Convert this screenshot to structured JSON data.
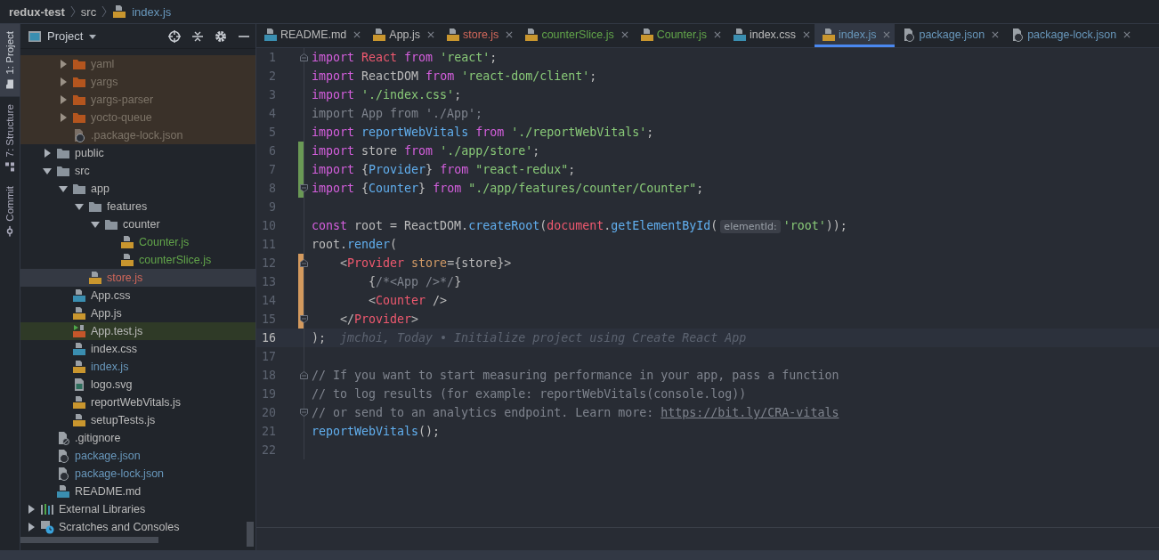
{
  "breadcrumb": [
    {
      "label": "redux-test",
      "kind": "project"
    },
    {
      "label": "src",
      "kind": "folder"
    },
    {
      "label": "index.js",
      "kind": "js"
    }
  ],
  "tool_strip": [
    {
      "label": "1: Project",
      "kind": "project",
      "selected": true
    },
    {
      "label": "7: Structure",
      "kind": "structure",
      "selected": false
    },
    {
      "label": "Commit",
      "kind": "commit",
      "selected": false
    }
  ],
  "project_panel": {
    "title": "Project",
    "tree": [
      {
        "children": [
          {
            "children": [
              {
                "label": "yaml",
                "kind": "folder",
                "expanded": false,
                "excluded": true,
                "selected": false,
                "color": "#7d7468"
              },
              {
                "label": "yargs",
                "kind": "folder",
                "expanded": false,
                "excluded": true,
                "selected": false,
                "color": "#7d7468"
              },
              {
                "label": "yargs-parser",
                "kind": "folder",
                "expanded": false,
                "excluded": true,
                "selected": false,
                "color": "#7d7468"
              },
              {
                "label": "yocto-queue",
                "kind": "folder",
                "expanded": false,
                "excluded": true,
                "selected": false,
                "color": "#7d7468"
              },
              {
                "label": ".package-lock.json",
                "kind": "json",
                "excluded": true,
                "selected": false,
                "color": "#7d7468"
              }
            ]
          },
          {
            "label": "public",
            "kind": "folder",
            "expanded": false,
            "excluded": false,
            "selected": false,
            "color": "#bbbbbb"
          },
          {
            "label": "src",
            "kind": "folder",
            "expanded": true,
            "excluded": false,
            "selected": false,
            "color": "#bbbbbb",
            "children": [
              {
                "label": "app",
                "kind": "folder",
                "expanded": true,
                "excluded": false,
                "selected": false,
                "color": "#bbbbbb",
                "children": [
                  {
                    "label": "features",
                    "kind": "folder",
                    "expanded": true,
                    "excluded": false,
                    "selected": false,
                    "color": "#bbbbbb",
                    "children": [
                      {
                        "label": "counter",
                        "kind": "folder",
                        "expanded": true,
                        "excluded": false,
                        "selected": false,
                        "color": "#bbbbbb",
                        "children": [
                          {
                            "label": "Counter.js",
                            "kind": "js",
                            "excluded": false,
                            "selected": false,
                            "color": "#62a54a"
                          },
                          {
                            "label": "counterSlice.js",
                            "kind": "js",
                            "excluded": false,
                            "selected": false,
                            "color": "#62a54a"
                          }
                        ]
                      }
                    ]
                  },
                  {
                    "label": "store.js",
                    "kind": "js",
                    "excluded": false,
                    "selected": true,
                    "color": "#d1675a"
                  }
                ]
              },
              {
                "label": "App.css",
                "kind": "css",
                "excluded": false,
                "selected": false,
                "color": "#bbbbbb"
              },
              {
                "label": "App.js",
                "kind": "js",
                "excluded": false,
                "selected": false,
                "color": "#bbbbbb"
              },
              {
                "label": "App.test.js",
                "kind": "test",
                "excluded": false,
                "selected": false,
                "color": "#bbbbbb"
              },
              {
                "label": "index.css",
                "kind": "css",
                "excluded": false,
                "selected": false,
                "color": "#bbbbbb"
              },
              {
                "label": "index.js",
                "kind": "js",
                "excluded": false,
                "selected": false,
                "color": "#6897bb"
              },
              {
                "label": "logo.svg",
                "kind": "image",
                "excluded": false,
                "selected": false,
                "color": "#bbbbbb"
              },
              {
                "label": "reportWebVitals.js",
                "kind": "js",
                "excluded": false,
                "selected": false,
                "color": "#bbbbbb"
              },
              {
                "label": "setupTests.js",
                "kind": "js",
                "excluded": false,
                "selected": false,
                "color": "#bbbbbb"
              }
            ]
          },
          {
            "label": ".gitignore",
            "kind": "ignore",
            "excluded": false,
            "selected": false,
            "color": "#bbbbbb"
          },
          {
            "label": "package.json",
            "kind": "json",
            "excluded": false,
            "selected": false,
            "color": "#6897bb"
          },
          {
            "label": "package-lock.json",
            "kind": "json",
            "excluded": false,
            "selected": false,
            "color": "#6897bb"
          },
          {
            "label": "README.md",
            "kind": "md",
            "excluded": false,
            "selected": false,
            "color": "#bbbbbb"
          }
        ]
      },
      {
        "label": "External Libraries",
        "kind": "libraries",
        "expanded": false,
        "excluded": false,
        "selected": false,
        "color": "#bbbbbb"
      },
      {
        "label": "Scratches and Consoles",
        "kind": "scratches",
        "expanded": false,
        "excluded": false,
        "selected": false,
        "color": "#bbbbbb"
      }
    ]
  },
  "tabs": [
    {
      "label": "README.md",
      "kind": "md",
      "color": "#bbbbbb",
      "selected": false
    },
    {
      "label": "App.js",
      "kind": "js",
      "color": "#bbbbbb",
      "selected": false
    },
    {
      "label": "store.js",
      "kind": "js",
      "color": "#d1675a",
      "selected": false
    },
    {
      "label": "counterSlice.js",
      "kind": "js",
      "color": "#62a54a",
      "selected": false
    },
    {
      "label": "Counter.js",
      "kind": "js",
      "color": "#62a54a",
      "selected": false
    },
    {
      "label": "index.css",
      "kind": "css",
      "color": "#bbbbbb",
      "selected": false
    },
    {
      "label": "index.js",
      "kind": "js",
      "color": "#6897bb",
      "selected": true
    },
    {
      "label": "package.json",
      "kind": "json",
      "color": "#6897bb",
      "selected": false
    },
    {
      "label": "package-lock.json",
      "kind": "json",
      "color": "#6897bb",
      "selected": false
    }
  ],
  "editor": {
    "lines": [
      {
        "number": "1",
        "added": false,
        "modified": false,
        "fold_start": true,
        "fold_end": false,
        "current": false,
        "tokens": [
          {
            "kind": "keyword",
            "text": "import"
          },
          {
            "kind": "class",
            "text": " React"
          },
          {
            "kind": "keyword",
            "text": " from"
          },
          {
            "kind": "string",
            "text": " 'react'"
          },
          {
            "kind": "plain",
            "text": ";"
          }
        ]
      },
      {
        "number": "2",
        "added": false,
        "modified": false,
        "fold_start": false,
        "fold_end": false,
        "current": false,
        "tokens": [
          {
            "kind": "keyword",
            "text": "import"
          },
          {
            "kind": "plain",
            "text": " ReactDOM"
          },
          {
            "kind": "keyword",
            "text": " from"
          },
          {
            "kind": "string",
            "text": " 'react-dom/client'"
          },
          {
            "kind": "plain",
            "text": ";"
          }
        ]
      },
      {
        "number": "3",
        "added": false,
        "modified": false,
        "fold_start": false,
        "fold_end": false,
        "current": false,
        "tokens": [
          {
            "kind": "keyword",
            "text": "import"
          },
          {
            "kind": "string",
            "text": " './index.css'"
          },
          {
            "kind": "plain",
            "text": ";"
          }
        ]
      },
      {
        "number": "4",
        "added": false,
        "modified": false,
        "fold_start": false,
        "fold_end": false,
        "current": false,
        "tokens": [
          {
            "kind": "unused",
            "text": "import App from './App';"
          }
        ]
      },
      {
        "number": "5",
        "added": false,
        "modified": false,
        "fold_start": false,
        "fold_end": false,
        "current": false,
        "tokens": [
          {
            "kind": "keyword",
            "text": "import"
          },
          {
            "kind": "function",
            "text": " reportWebVitals"
          },
          {
            "kind": "keyword",
            "text": " from"
          },
          {
            "kind": "string",
            "text": " './reportWebVitals'"
          },
          {
            "kind": "plain",
            "text": ";"
          }
        ]
      },
      {
        "number": "6",
        "added": true,
        "modified": false,
        "fold_start": false,
        "fold_end": false,
        "current": false,
        "tokens": [
          {
            "kind": "keyword",
            "text": "import"
          },
          {
            "kind": "plain",
            "text": " store"
          },
          {
            "kind": "keyword",
            "text": " from"
          },
          {
            "kind": "string",
            "text": " './app/store'"
          },
          {
            "kind": "plain",
            "text": ";"
          }
        ]
      },
      {
        "number": "7",
        "added": true,
        "modified": false,
        "fold_start": false,
        "fold_end": false,
        "current": false,
        "tokens": [
          {
            "kind": "keyword",
            "text": "import"
          },
          {
            "kind": "plain",
            "text": " {"
          },
          {
            "kind": "function",
            "text": "Provider"
          },
          {
            "kind": "plain",
            "text": "}"
          },
          {
            "kind": "keyword",
            "text": " from"
          },
          {
            "kind": "string",
            "text": " \"react-redux\""
          },
          {
            "kind": "plain",
            "text": ";"
          }
        ]
      },
      {
        "number": "8",
        "added": true,
        "modified": false,
        "fold_start": false,
        "fold_end": true,
        "current": false,
        "tokens": [
          {
            "kind": "keyword",
            "text": "import"
          },
          {
            "kind": "plain",
            "text": " {"
          },
          {
            "kind": "function",
            "text": "Counter"
          },
          {
            "kind": "plain",
            "text": "}"
          },
          {
            "kind": "keyword",
            "text": " from"
          },
          {
            "kind": "string",
            "text": " \"./app/features/counter/Counter\""
          },
          {
            "kind": "plain",
            "text": ";"
          }
        ]
      },
      {
        "number": "9",
        "added": false,
        "modified": false,
        "fold_start": false,
        "fold_end": false,
        "current": false
      },
      {
        "number": "10",
        "added": false,
        "modified": false,
        "fold_start": false,
        "fold_end": false,
        "current": false,
        "tokens": [
          {
            "kind": "keyword",
            "text": "const"
          },
          {
            "kind": "plain",
            "text": " root = ReactDOM."
          },
          {
            "kind": "function",
            "text": "createRoot"
          },
          {
            "kind": "plain",
            "text": "("
          },
          {
            "kind": "global",
            "text": "document"
          },
          {
            "kind": "plain",
            "text": "."
          },
          {
            "kind": "function",
            "text": "getElementById"
          },
          {
            "kind": "plain",
            "text": "("
          },
          {
            "kind": "hint",
            "text": "elementId:"
          },
          {
            "kind": "string",
            "text": "'root'"
          },
          {
            "kind": "plain",
            "text": "));"
          }
        ]
      },
      {
        "number": "11",
        "added": false,
        "modified": false,
        "fold_start": false,
        "fold_end": false,
        "current": false,
        "tokens": [
          {
            "kind": "plain",
            "text": "root."
          },
          {
            "kind": "function",
            "text": "render"
          },
          {
            "kind": "plain",
            "text": "("
          }
        ]
      },
      {
        "number": "12",
        "added": false,
        "modified": true,
        "fold_start": true,
        "fold_end": false,
        "current": false,
        "tokens": [
          {
            "kind": "plain",
            "text": "    <"
          },
          {
            "kind": "tag",
            "text": "Provider"
          },
          {
            "kind": "attribute",
            "text": " store"
          },
          {
            "kind": "plain",
            "text": "={store}>"
          }
        ]
      },
      {
        "number": "13",
        "added": false,
        "modified": true,
        "fold_start": false,
        "fold_end": false,
        "current": false,
        "tokens": [
          {
            "kind": "plain",
            "text": "        {"
          },
          {
            "kind": "unused",
            "text": "/*<App />*/"
          },
          {
            "kind": "plain",
            "text": "}"
          }
        ]
      },
      {
        "number": "14",
        "added": false,
        "modified": true,
        "fold_start": false,
        "fold_end": false,
        "current": false,
        "tokens": [
          {
            "kind": "plain",
            "text": "        <"
          },
          {
            "kind": "tag",
            "text": "Counter"
          },
          {
            "kind": "plain",
            "text": " />"
          }
        ]
      },
      {
        "number": "15",
        "added": false,
        "modified": true,
        "fold_start": false,
        "fold_end": true,
        "current": false,
        "tokens": [
          {
            "kind": "plain",
            "text": "    </"
          },
          {
            "kind": "tag",
            "text": "Provider"
          },
          {
            "kind": "plain",
            "text": ">"
          }
        ]
      },
      {
        "number": "16",
        "added": false,
        "modified": false,
        "fold_start": false,
        "fold_end": false,
        "current": true,
        "tokens": [
          {
            "kind": "plain",
            "text": ");"
          }
        ],
        "annotation": "jmchoi, Today • Initialize project using Create React App"
      },
      {
        "number": "17",
        "added": false,
        "modified": false,
        "fold_start": false,
        "fold_end": false,
        "current": false
      },
      {
        "number": "18",
        "added": false,
        "modified": false,
        "fold_start": true,
        "fold_end": false,
        "current": false,
        "tokens": [
          {
            "kind": "comment",
            "text": "// If you want to start measuring performance in your app, pass a function"
          }
        ]
      },
      {
        "number": "19",
        "added": false,
        "modified": false,
        "fold_start": false,
        "fold_end": false,
        "current": false,
        "tokens": [
          {
            "kind": "comment",
            "text": "// to log results (for example: reportWebVitals(console.log))"
          }
        ]
      },
      {
        "number": "20",
        "added": false,
        "modified": false,
        "fold_start": false,
        "fold_end": true,
        "current": false,
        "tokens": [
          {
            "kind": "comment",
            "text": "// or send to an analytics endpoint. Learn more: "
          },
          {
            "kind": "link",
            "text": "https://bit.ly/CRA-vitals"
          }
        ]
      },
      {
        "number": "21",
        "added": false,
        "modified": false,
        "fold_start": false,
        "fold_end": false,
        "current": false,
        "tokens": [
          {
            "kind": "function",
            "text": "reportWebVitals"
          },
          {
            "kind": "plain",
            "text": "();"
          }
        ]
      },
      {
        "number": "22",
        "added": false,
        "modified": false,
        "fold_start": false,
        "fold_end": false,
        "current": false
      }
    ]
  }
}
